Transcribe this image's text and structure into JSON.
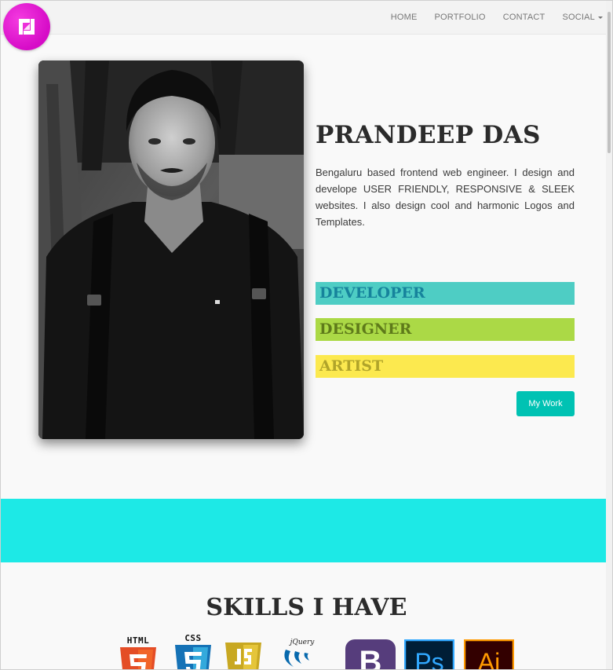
{
  "nav": {
    "items": [
      {
        "label": "HOME"
      },
      {
        "label": "PORTFOLIO"
      },
      {
        "label": "CONTACT"
      },
      {
        "label": "SOCIAL"
      }
    ]
  },
  "hero": {
    "name": "PRANDEEP DAS",
    "bio": "Bengaluru based frontend web engineer. I design and develope USER FRIENDLY, RESPONSIVE & SLEEK websites. I also design cool and harmonic Logos and Templates.",
    "roles": [
      {
        "label": "DEVELOPER",
        "color": "#4ecdc4"
      },
      {
        "label": "DESIGNER",
        "color": "#abd946"
      },
      {
        "label": "ARTIST",
        "color": "#fce94f"
      }
    ],
    "cta": "My Work"
  },
  "colors": {
    "accent": "#00c2b3",
    "band": "#1de9e6",
    "logo": "#d60bc7"
  },
  "skills": {
    "title": "SKILLS I HAVE",
    "items": [
      {
        "label": "HTML",
        "icon": "html5-icon"
      },
      {
        "label": "CSS",
        "icon": "css3-icon"
      },
      {
        "label": "",
        "icon": "javascript-icon"
      },
      {
        "label": "jQuery",
        "icon": "jquery-icon"
      },
      {
        "label": "",
        "icon": "bootstrap-icon"
      },
      {
        "label": "Ps",
        "icon": "photoshop-icon"
      },
      {
        "label": "Ai",
        "icon": "illustrator-icon"
      }
    ]
  }
}
